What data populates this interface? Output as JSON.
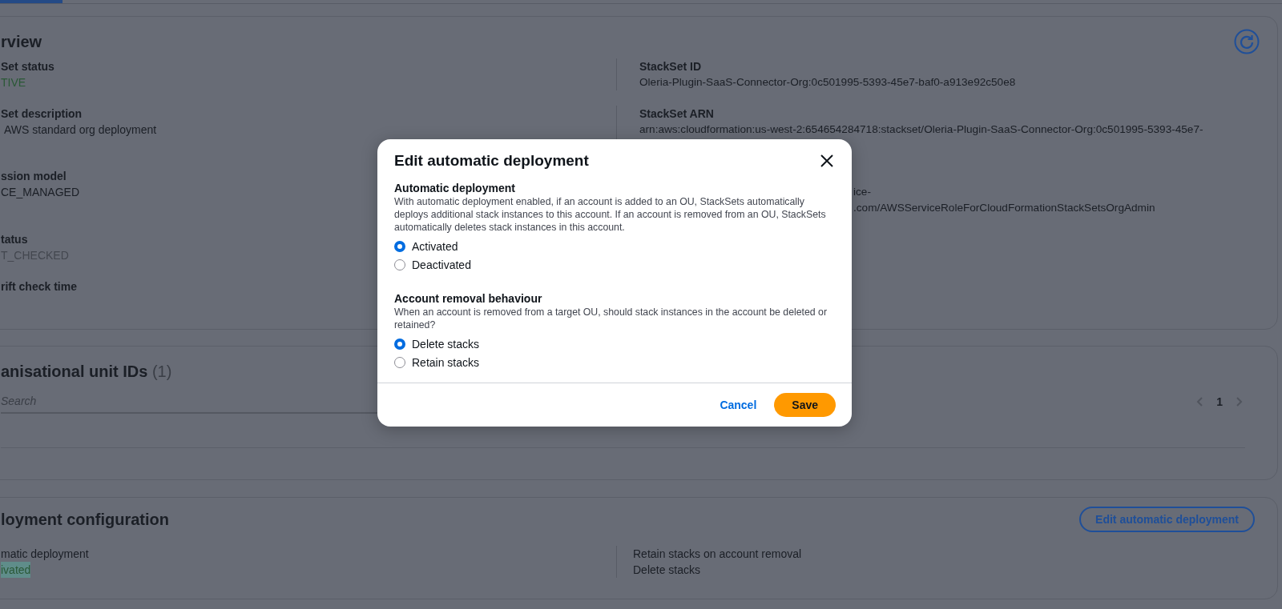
{
  "overview": {
    "title": "rview",
    "rows": [
      {
        "left": {
          "label": "Set status",
          "value": "TIVE",
          "kind": "success"
        },
        "right": {
          "label": "StackSet ID",
          "lines": [
            "Oleria-Plugin-SaaS-Connector-Org:0c501995-5393-45e7-baf0-a913e92c50e8"
          ]
        }
      },
      {
        "left": {
          "label": "Set description",
          "value": "AWS standard org deployment",
          "kind": "plain"
        },
        "right": {
          "label": "StackSet ARN",
          "lines": [
            "arn:aws:cloudformation:us-west-2:654654284718:stackset/Oleria-Plugin-SaaS-Connector-Org:0c501995-5393-45e7-"
          ]
        }
      },
      {
        "left": {
          "label": "ssion model",
          "value": "CE_MANAGED",
          "kind": "plain"
        },
        "right": {
          "lines": [
            "ice-",
            ".com/AWSServiceRoleForCloudFormationStackSetsOrgAdmin"
          ]
        }
      },
      {
        "left": {
          "label": "tatus",
          "value": "T_CHECKED",
          "kind": "muted"
        }
      },
      {
        "left": {
          "label": "rift check time"
        }
      }
    ]
  },
  "org_units": {
    "title": "anisational unit IDs",
    "count": "(1)",
    "search": {
      "placeholder": "Search"
    },
    "pagination": {
      "prev": {
        "disabled": true
      },
      "page": "1",
      "next": {
        "disabled": true
      }
    }
  },
  "deployment": {
    "title": "loyment configuration",
    "edit_button": "Edit automatic deployment",
    "fields": [
      {
        "label": "matic deployment",
        "value": "ivated",
        "kind": "highlighted"
      },
      {
        "label": "Retain stacks on account removal",
        "value": "Delete stacks",
        "kind": "plain"
      }
    ]
  },
  "modal": {
    "title": "Edit automatic deployment",
    "sections": [
      {
        "heading": "Automatic deployment",
        "description": "With automatic deployment enabled, if an account is added to an OU, StackSets automatically deploys additional stack instances to this account. If an account is removed from an OU, StackSets automatically deletes stack instances in this account.",
        "options": [
          {
            "label": "Activated",
            "selected": true
          },
          {
            "label": "Deactivated",
            "selected": false
          }
        ]
      },
      {
        "heading": "Account removal behaviour",
        "description": "When an account is removed from a target OU, should stack instances in the account be deleted or retained?",
        "options": [
          {
            "label": "Delete stacks",
            "selected": true
          },
          {
            "label": "Retain stacks",
            "selected": false
          }
        ]
      }
    ],
    "cancel": "Cancel",
    "save": "Save"
  }
}
